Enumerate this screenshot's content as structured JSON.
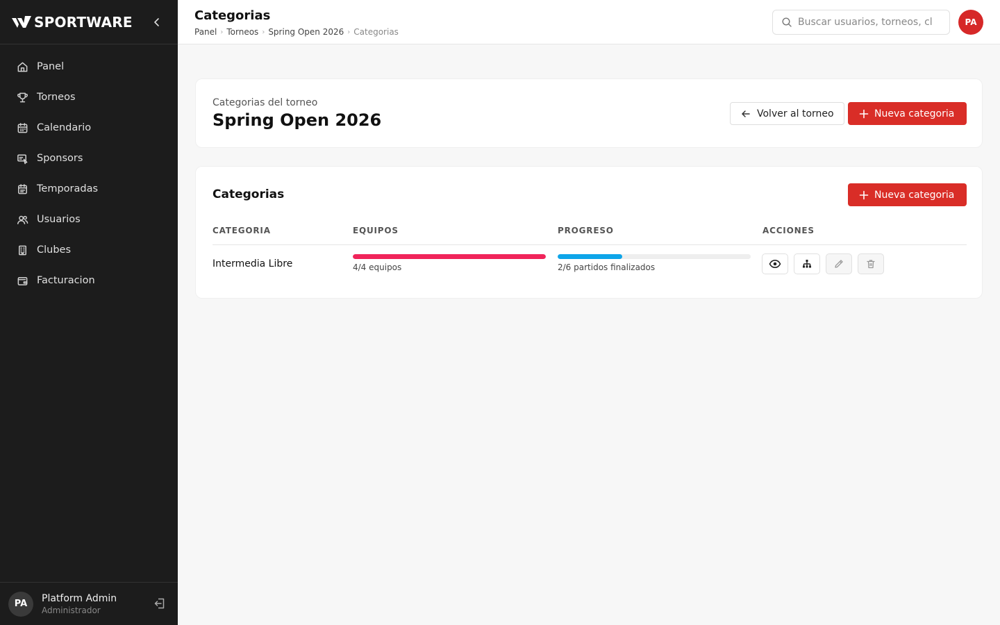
{
  "app": {
    "brand": "SPORTWARE"
  },
  "sidebar": {
    "items": [
      {
        "label": "Panel",
        "icon": "home-icon"
      },
      {
        "label": "Torneos",
        "icon": "trophy-icon"
      },
      {
        "label": "Calendario",
        "icon": "calendar-icon"
      },
      {
        "label": "Sponsors",
        "icon": "sponsor-icon"
      },
      {
        "label": "Temporadas",
        "icon": "season-icon"
      },
      {
        "label": "Usuarios",
        "icon": "users-icon"
      },
      {
        "label": "Clubes",
        "icon": "building-icon"
      },
      {
        "label": "Facturacion",
        "icon": "wallet-icon"
      }
    ],
    "user": {
      "initials": "PA",
      "name": "Platform Admin",
      "role": "Administrador"
    }
  },
  "header": {
    "title": "Categorias",
    "breadcrumb": [
      "Panel",
      "Torneos",
      "Spring Open 2026",
      "Categorias"
    ],
    "search_placeholder": "Buscar usuarios, torneos, cl",
    "avatar_initials": "PA"
  },
  "tournament_card": {
    "subtitle": "Categorias del torneo",
    "title": "Spring Open 2026",
    "back_label": "Volver al torneo",
    "new_label": "Nueva categoria"
  },
  "categories_card": {
    "title": "Categorias",
    "new_label": "Nueva categoria",
    "columns": [
      "CATEGORIA",
      "EQUIPOS",
      "PROGRESO",
      "ACCIONES"
    ],
    "rows": [
      {
        "name": "Intermedia Libre",
        "teams_text": "4/4 equipos",
        "teams_fraction": 1.0,
        "progress_text": "2/6 partidos finalizados",
        "progress_fraction": 0.333
      }
    ]
  },
  "colors": {
    "accent": "#d92d27",
    "teams_bar": "#f0245a",
    "progress_bar": "#0ea5e9",
    "sidebar_bg": "#1c1c1c"
  }
}
